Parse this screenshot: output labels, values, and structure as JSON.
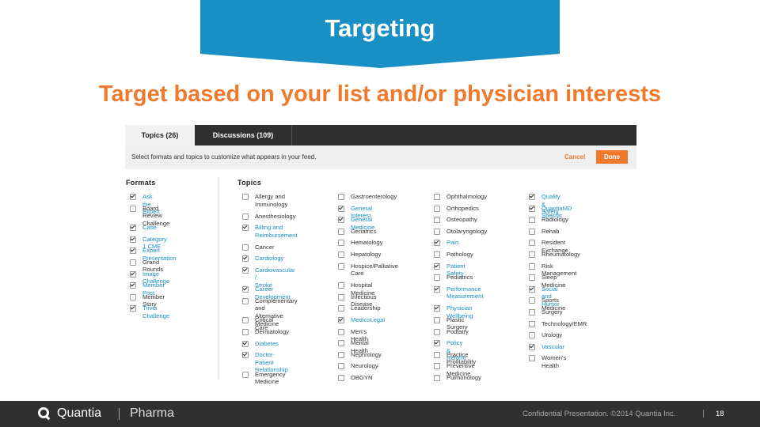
{
  "slide": {
    "title": "Targeting",
    "headline": "Target based on your list and/or physician interests"
  },
  "tabs": {
    "topics": "Topics (26)",
    "discussions": "Discussions (109)"
  },
  "toolbar": {
    "instructions": "Select formats and topics to customize what appears in your feed.",
    "cancel_label": "Cancel",
    "done_label": "Done"
  },
  "formats": {
    "title": "Formats",
    "items": [
      {
        "label": "Ask the Expert",
        "checked": true
      },
      {
        "label": "Board Review\nChallenge",
        "checked": false
      },
      {
        "label": "Case",
        "checked": true
      },
      {
        "label": "Category 1 CME",
        "checked": true
      },
      {
        "label": "Expert Presentation",
        "checked": true
      },
      {
        "label": "Grand Rounds",
        "checked": false
      },
      {
        "label": "Image Challenge",
        "checked": true
      },
      {
        "label": "Member Post",
        "checked": true
      },
      {
        "label": "Member Story",
        "checked": false
      },
      {
        "label": "Trivia Challenge",
        "checked": true
      }
    ]
  },
  "topics": {
    "title": "Topics",
    "columns": [
      [
        {
          "label": "Allergy and\nImmunology",
          "checked": false
        },
        {
          "label": "Anesthesiology",
          "checked": false
        },
        {
          "label": "Billing and\nReimbursement",
          "checked": true
        },
        {
          "label": "Cancer",
          "checked": false
        },
        {
          "label": "Cardiology",
          "checked": true
        },
        {
          "label": "Cardiovascular /\nStroke",
          "checked": true
        },
        {
          "label": "Career Development",
          "checked": true
        },
        {
          "label": "Complementary and\nAlternative Medicine",
          "checked": false
        },
        {
          "label": "Critical Care",
          "checked": false
        },
        {
          "label": "Dermatology",
          "checked": false
        },
        {
          "label": "Diabetes",
          "checked": true
        },
        {
          "label": "Doctor-Patient\nRelationship",
          "checked": true
        },
        {
          "label": "Emergency Medicine",
          "checked": false
        }
      ],
      [
        {
          "label": "Gastroenterology",
          "checked": false
        },
        {
          "label": "General Interest",
          "checked": true
        },
        {
          "label": "General Medicine",
          "checked": true
        },
        {
          "label": "Geriatrics",
          "checked": false
        },
        {
          "label": "Hematology",
          "checked": false
        },
        {
          "label": "Hepatology",
          "checked": false
        },
        {
          "label": "Hospice/Palliative\nCare",
          "checked": false
        },
        {
          "label": "Hospital Medicine",
          "checked": false
        },
        {
          "label": "Infectious Disease",
          "checked": false
        },
        {
          "label": "Leadership",
          "checked": false
        },
        {
          "label": "MedicoLegal",
          "checked": true
        },
        {
          "label": "Men's Health",
          "checked": false
        },
        {
          "label": "Mental Health",
          "checked": false
        },
        {
          "label": "Nephrology",
          "checked": false
        },
        {
          "label": "Neurology",
          "checked": false
        },
        {
          "label": "OBGYN",
          "checked": false
        }
      ],
      [
        {
          "label": "Ophthalmology",
          "checked": false
        },
        {
          "label": "Orthopedics",
          "checked": false
        },
        {
          "label": "Osteopathy",
          "checked": false
        },
        {
          "label": "Otolaryngology",
          "checked": false
        },
        {
          "label": "Pain",
          "checked": true
        },
        {
          "label": "Pathology",
          "checked": false
        },
        {
          "label": "Patient Safety",
          "checked": true
        },
        {
          "label": "Pediatrics",
          "checked": false
        },
        {
          "label": "Performance\nMeasurement",
          "checked": true
        },
        {
          "label": "Physician Wellbeing",
          "checked": true
        },
        {
          "label": "Plastic Surgery",
          "checked": false
        },
        {
          "label": "Podiatry",
          "checked": false
        },
        {
          "label": "Policy & Reform",
          "checked": true
        },
        {
          "label": "Practice Profitability",
          "checked": false
        },
        {
          "label": "Preventive Medicine",
          "checked": false
        },
        {
          "label": "Pulmonology",
          "checked": false
        }
      ],
      [
        {
          "label": "Quality & Safety",
          "checked": true
        },
        {
          "label": "QuantiaMD Specific",
          "checked": true
        },
        {
          "label": "Radiology",
          "checked": false
        },
        {
          "label": "Rehab",
          "checked": false
        },
        {
          "label": "Resident Exchange",
          "checked": false
        },
        {
          "label": "Rheumatology",
          "checked": false
        },
        {
          "label": "Risk Management",
          "checked": false
        },
        {
          "label": "Sleep Medicine",
          "checked": false
        },
        {
          "label": "Social and Humor",
          "checked": true
        },
        {
          "label": "Sports Medicine",
          "checked": false
        },
        {
          "label": "Surgery",
          "checked": false
        },
        {
          "label": "Technology/EMR",
          "checked": false
        },
        {
          "label": "Urology",
          "checked": false
        },
        {
          "label": "Vascular",
          "checked": true
        },
        {
          "label": "Women's Health",
          "checked": false
        }
      ]
    ]
  },
  "footer": {
    "brand": "Quantia",
    "division": "Pharma",
    "confidential": "Confidential Presentation. ©2014 Quantia Inc.",
    "page_number": "18"
  },
  "colors": {
    "brand_blue": "#1a8fc4",
    "accent_orange": "#ef7a2e",
    "footer_bg": "#303030"
  }
}
